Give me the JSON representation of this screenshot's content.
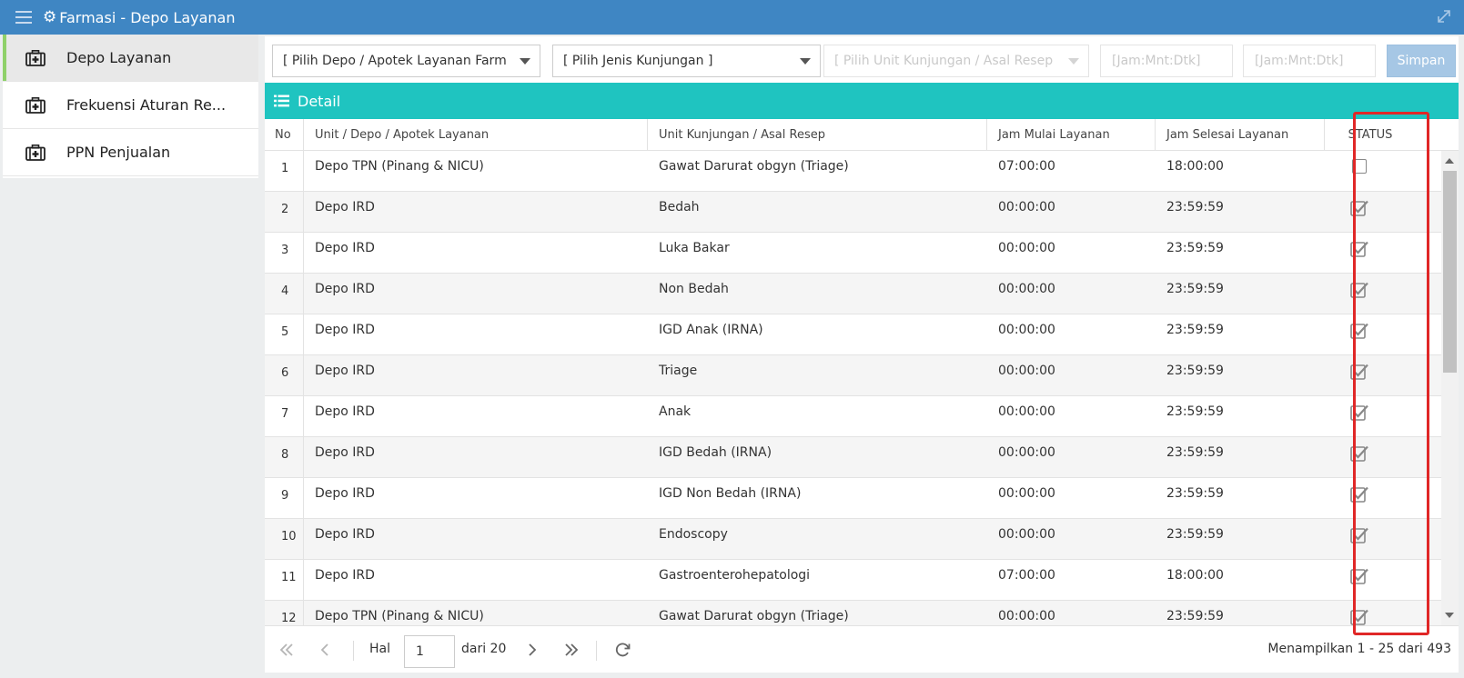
{
  "app": {
    "title": "Farmasi - Depo Layanan",
    "accent": "#3f86c3",
    "panel_color": "#1fc4c0",
    "highlight_color": "#e02727"
  },
  "sidebar": {
    "items": [
      {
        "label": "Depo Layanan",
        "icon": "medkit-icon",
        "active": true
      },
      {
        "label": "Frekuensi Aturan Re...",
        "icon": "medkit-icon",
        "active": false
      },
      {
        "label": "PPN Penjualan",
        "icon": "medkit-icon",
        "active": false
      }
    ]
  },
  "toolbar": {
    "depo_placeholder": "[ Pilih Depo / Apotek Layanan Farmasi ]",
    "jenis_placeholder": "[ Pilih Jenis Kunjungan ]",
    "unit_placeholder": "[ Pilih Unit Kunjungan / Asal Resep ]",
    "jam_mulai_placeholder": "[Jam:Mnt:Dtk]",
    "jam_selesai_placeholder": "[Jam:Mnt:Dtk]",
    "save_label": "Simpan"
  },
  "panel": {
    "title": "Detail"
  },
  "table": {
    "headers": {
      "no": "No",
      "depo": "Unit / Depo / Apotek Layanan",
      "unit": "Unit Kunjungan / Asal Resep",
      "mulai": "Jam Mulai Layanan",
      "selesai": "Jam Selesai Layanan",
      "status": "STATUS"
    },
    "rows": [
      {
        "no": "1",
        "depo": "Depo TPN (Pinang & NICU)",
        "unit": "Gawat Darurat obgyn (Triage)",
        "mulai": "07:00:00",
        "selesai": "18:00:00",
        "status": false
      },
      {
        "no": "2",
        "depo": "Depo IRD",
        "unit": "Bedah",
        "mulai": "00:00:00",
        "selesai": "23:59:59",
        "status": true
      },
      {
        "no": "3",
        "depo": "Depo IRD",
        "unit": "Luka Bakar",
        "mulai": "00:00:00",
        "selesai": "23:59:59",
        "status": true
      },
      {
        "no": "4",
        "depo": "Depo IRD",
        "unit": "Non Bedah",
        "mulai": "00:00:00",
        "selesai": "23:59:59",
        "status": true
      },
      {
        "no": "5",
        "depo": "Depo IRD",
        "unit": "IGD Anak (IRNA)",
        "mulai": "00:00:00",
        "selesai": "23:59:59",
        "status": true
      },
      {
        "no": "6",
        "depo": "Depo IRD",
        "unit": "Triage",
        "mulai": "00:00:00",
        "selesai": "23:59:59",
        "status": true
      },
      {
        "no": "7",
        "depo": "Depo IRD",
        "unit": "Anak",
        "mulai": "00:00:00",
        "selesai": "23:59:59",
        "status": true
      },
      {
        "no": "8",
        "depo": "Depo IRD",
        "unit": "IGD Bedah (IRNA)",
        "mulai": "00:00:00",
        "selesai": "23:59:59",
        "status": true
      },
      {
        "no": "9",
        "depo": "Depo IRD",
        "unit": "IGD Non Bedah (IRNA)",
        "mulai": "00:00:00",
        "selesai": "23:59:59",
        "status": true
      },
      {
        "no": "10",
        "depo": "Depo IRD",
        "unit": "Endoscopy",
        "mulai": "00:00:00",
        "selesai": "23:59:59",
        "status": true
      },
      {
        "no": "11",
        "depo": "Depo IRD",
        "unit": "Gastroenterohepatologi",
        "mulai": "07:00:00",
        "selesai": "18:00:00",
        "status": true
      },
      {
        "no": "12",
        "depo": "Depo TPN (Pinang & NICU)",
        "unit": "Gawat Darurat obgyn (Triage)",
        "mulai": "00:00:00",
        "selesai": "23:59:59",
        "status": true
      }
    ]
  },
  "pager": {
    "hal_label": "Hal",
    "page": "1",
    "of_label": "dari 20",
    "info": "Menampilkan 1 - 25 dari 493"
  }
}
